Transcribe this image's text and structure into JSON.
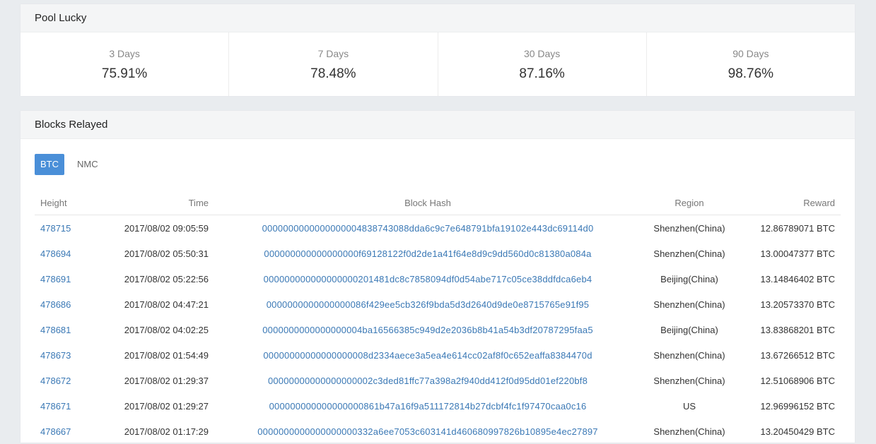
{
  "pool_lucky": {
    "title": "Pool Lucky",
    "stats": [
      {
        "label": "3 Days",
        "value": "75.91%"
      },
      {
        "label": "7 Days",
        "value": "78.48%"
      },
      {
        "label": "30 Days",
        "value": "87.16%"
      },
      {
        "label": "90 Days",
        "value": "98.76%"
      }
    ]
  },
  "blocks_relayed": {
    "title": "Blocks Relayed",
    "tabs": [
      {
        "label": "BTC",
        "active": true
      },
      {
        "label": "NMC",
        "active": false
      }
    ],
    "columns": {
      "height": "Height",
      "time": "Time",
      "hash": "Block Hash",
      "region": "Region",
      "reward": "Reward"
    },
    "rows": [
      {
        "height": "478715",
        "time": "2017/08/02 09:05:59",
        "hash": "0000000000000000004838743088dda6c9c7e648791bfa19102e443dc69114d0",
        "region": "Shenzhen(China)",
        "reward": "12.86789071 BTC"
      },
      {
        "height": "478694",
        "time": "2017/08/02 05:50:31",
        "hash": "000000000000000000f69128122f0d2de1a41f64e8d9c9dd560d0c81380a084a",
        "region": "Shenzhen(China)",
        "reward": "13.00047377 BTC"
      },
      {
        "height": "478691",
        "time": "2017/08/02 05:22:56",
        "hash": "000000000000000000201481dc8c7858094df0d54abe717c05ce38ddfdca6eb4",
        "region": "Beijing(China)",
        "reward": "13.14846402 BTC"
      },
      {
        "height": "478686",
        "time": "2017/08/02 04:47:21",
        "hash": "0000000000000000086f429ee5cb326f9bda5d3d2640d9de0e8715765e91f95",
        "region": "Shenzhen(China)",
        "reward": "13.20573370 BTC"
      },
      {
        "height": "478681",
        "time": "2017/08/02 04:02:25",
        "hash": "0000000000000000004ba16566385c949d2e2036b8b41a54b3df20787295faa5",
        "region": "Beijing(China)",
        "reward": "13.83868201 BTC"
      },
      {
        "height": "478673",
        "time": "2017/08/02 01:54:49",
        "hash": "00000000000000000008d2334aece3a5ea4e614cc02af8f0c652eaffa8384470d",
        "region": "Shenzhen(China)",
        "reward": "13.67266512 BTC"
      },
      {
        "height": "478672",
        "time": "2017/08/02 01:29:37",
        "hash": "00000000000000000002c3ded81ffc77a398a2f940dd412f0d95dd01ef220bf8",
        "region": "Shenzhen(China)",
        "reward": "12.51068906 BTC"
      },
      {
        "height": "478671",
        "time": "2017/08/02 01:29:27",
        "hash": "000000000000000000861b47a16f9a511172814b27dcbf4fc1f97470caa0c16",
        "region": "US",
        "reward": "12.96996152 BTC"
      },
      {
        "height": "478667",
        "time": "2017/08/02 01:17:29",
        "hash": "0000000000000000000332a6ee7053c603141d460680997826b10895e4ec27897",
        "region": "Shenzhen(China)",
        "reward": "13.20450429 BTC"
      }
    ]
  }
}
